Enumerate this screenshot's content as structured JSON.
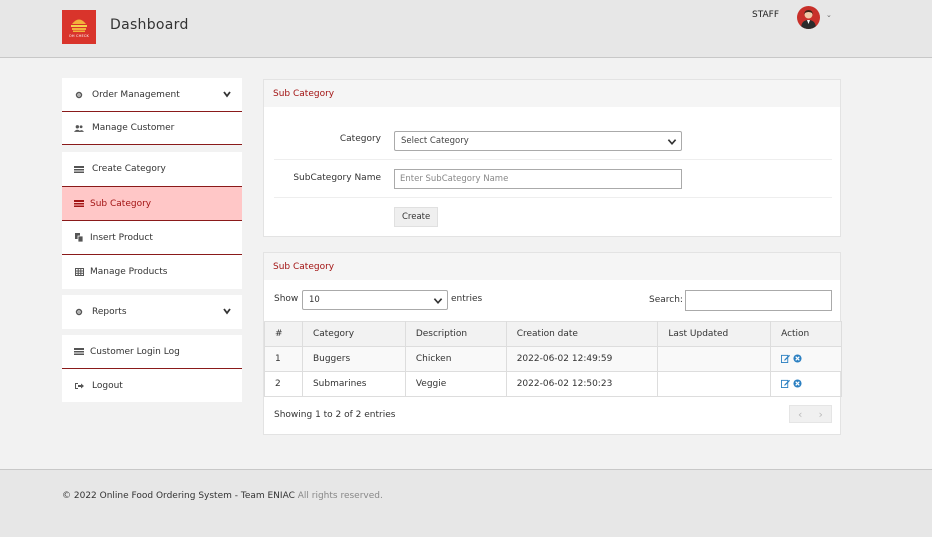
{
  "header": {
    "logo_text": "OH CHECK",
    "title": "Dashboard",
    "user_role": "STAFF",
    "avatar_caret": "⌄"
  },
  "sidebar": {
    "items": [
      {
        "label": "Order Management",
        "icon": "gear-icon",
        "expandable": true
      },
      {
        "label": "Manage Customer",
        "icon": "users-icon"
      },
      {
        "label": "Create Category",
        "icon": "category-icon"
      },
      {
        "label": "Sub Category",
        "icon": "category-icon",
        "active": true
      },
      {
        "label": "Insert Product",
        "icon": "copy-icon"
      },
      {
        "label": "Manage Products",
        "icon": "table-icon"
      },
      {
        "label": "Reports",
        "icon": "gear-icon",
        "expandable": true
      },
      {
        "label": "Customer Login Log",
        "icon": "category-icon"
      },
      {
        "label": "Logout",
        "icon": "logout-icon"
      }
    ]
  },
  "form_panel": {
    "title": "Sub Category",
    "category_label": "Category",
    "category_value": "Select Category",
    "subcategory_label": "SubCategory Name",
    "subcategory_placeholder": "Enter SubCategory Name",
    "create_label": "Create"
  },
  "table_panel": {
    "title": "Sub Category",
    "show_label": "Show",
    "length_value": "10",
    "entries_label": "entries",
    "search_label": "Search:",
    "columns": [
      "#",
      "Category",
      "Description",
      "Creation date",
      "Last Updated",
      "Action"
    ],
    "rows": [
      {
        "num": "1",
        "category": "Buggers",
        "description": "Chicken",
        "created": "2022-06-02 12:49:59",
        "updated": ""
      },
      {
        "num": "2",
        "category": "Submarines",
        "description": "Veggie",
        "created": "2022-06-02 12:50:23",
        "updated": ""
      }
    ],
    "info": "Showing 1 to 2 of 2 entries",
    "prev": "‹",
    "next": "›"
  },
  "footer": {
    "text": "© 2022 Online Food Ordering System - Team ENIAC",
    "muted": "All rights reserved."
  },
  "colors": {
    "accent": "#a31515",
    "active_bg": "#ffc7c7",
    "logo_bg": "#d9342b",
    "action_icon": "#2a7fc1"
  }
}
